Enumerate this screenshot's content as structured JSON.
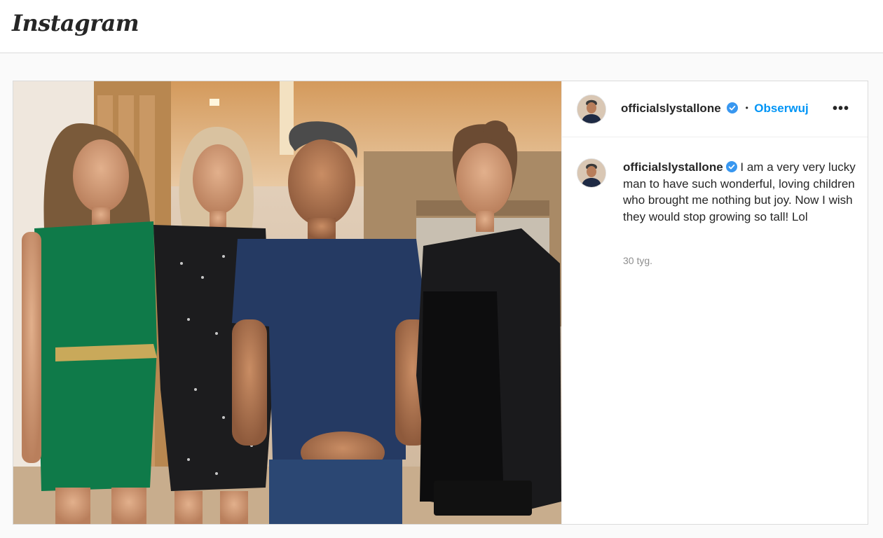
{
  "app": {
    "logo_text": "Instagram"
  },
  "post": {
    "username": "officialslystallone",
    "verified": true,
    "separator": "•",
    "follow_label": "Obserwuj",
    "more_label": "•••",
    "caption": "I am a very very lucky man to have such wonderful, loving children who brought me nothing but joy. Now I wish they would stop growing so tall! Lol",
    "time_ago": "30 tyg."
  },
  "colors": {
    "accent": "#0095f6",
    "verified_badge": "#3897f0",
    "text": "#262626",
    "muted": "#8e8e8e",
    "border": "#dbdbdb"
  },
  "icons": [
    "verified-badge-icon",
    "more-options-icon"
  ]
}
